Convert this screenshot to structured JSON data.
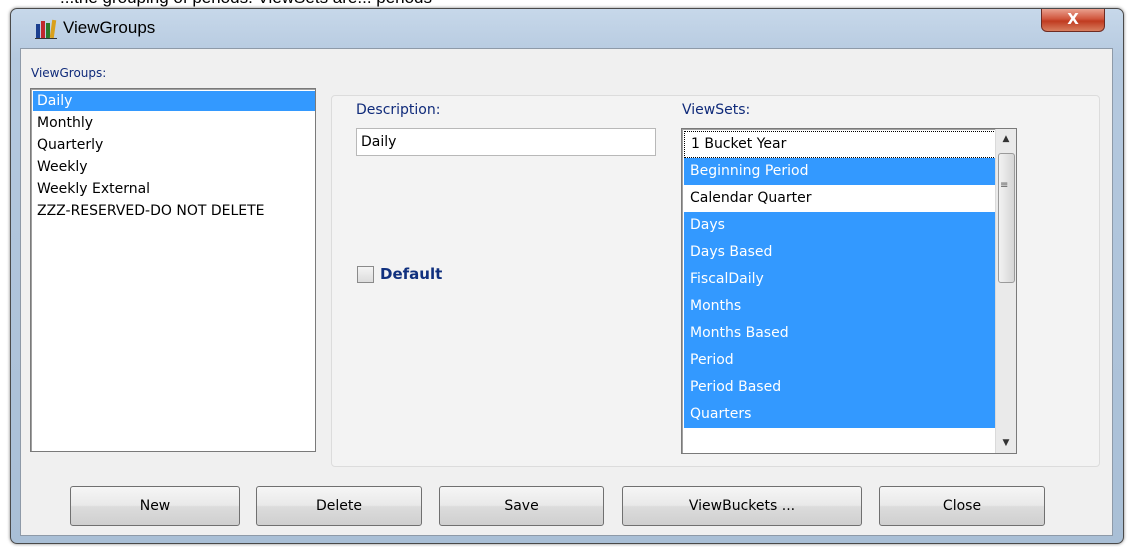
{
  "header_caption": "...the grouping of periods. ViewSets are... periods",
  "window": {
    "title": "ViewGroups",
    "close_glyph": "X"
  },
  "viewgroups": {
    "label": "ViewGroups:",
    "items": [
      "Daily",
      "Monthly",
      "Quarterly",
      "Weekly",
      "Weekly External",
      "ZZZ-RESERVED-DO NOT DELETE"
    ],
    "selected": "Daily"
  },
  "details": {
    "description_label": "Description:",
    "description_value": "Daily",
    "default_label": "Default",
    "default_checked": false
  },
  "viewsets": {
    "label": "ViewSets:",
    "items": [
      {
        "label": "1 Bucket Year",
        "selected": false
      },
      {
        "label": "Beginning Period",
        "selected": true
      },
      {
        "label": "Calendar Quarter",
        "selected": false
      },
      {
        "label": "Days",
        "selected": true
      },
      {
        "label": "Days Based",
        "selected": true
      },
      {
        "label": "FiscalDaily",
        "selected": true
      },
      {
        "label": "Months",
        "selected": true
      },
      {
        "label": "Months Based",
        "selected": true
      },
      {
        "label": "Period",
        "selected": true
      },
      {
        "label": "Period Based",
        "selected": true
      },
      {
        "label": "Quarters",
        "selected": true
      }
    ]
  },
  "buttons": {
    "new": "New",
    "delete": "Delete",
    "save": "Save",
    "viewbuckets": "ViewBuckets ...",
    "close": "Close"
  },
  "colors": {
    "selection": "#3399ff",
    "label_blue": "#0f2a7a",
    "close_red": "#c03b20"
  },
  "icons": {
    "app": "books-icon",
    "close": "close-icon",
    "scroll_up": "chevron-up-icon",
    "scroll_down": "chevron-down-icon"
  }
}
